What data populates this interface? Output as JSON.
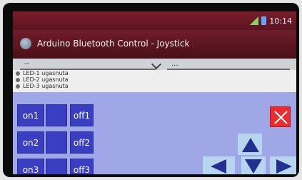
{
  "app": {
    "title": "Arduino Bluetooth Control - Joystick"
  },
  "status": {
    "time": "10:14"
  },
  "toolbar": {
    "left_label": "--",
    "right_label": "..."
  },
  "led_list": {
    "items": [
      {
        "label": "LED-1 ugasnuta"
      },
      {
        "label": "LED-2 ugasnuta"
      },
      {
        "label": "LED-3 ugasnuta"
      }
    ]
  },
  "buttons": {
    "on1": "on1",
    "off1": "off1",
    "on2": "on2",
    "off2": "off2",
    "on3": "on3",
    "off3": "off3"
  },
  "icons": {
    "close": "close-icon",
    "arrow_up": "arrow-up-icon",
    "arrow_left": "arrow-left-icon",
    "arrow_down": "arrow-down-icon",
    "arrow_right": "arrow-right-icon"
  },
  "colors": {
    "button_blue": "#3a3fc2",
    "panel_lavender": "#9fa7e7",
    "close_red": "#ee2c2c",
    "arrow_navy": "#23308f",
    "arrow_tile": "#b8d5f0",
    "title_bar": "#6f1d2a"
  }
}
